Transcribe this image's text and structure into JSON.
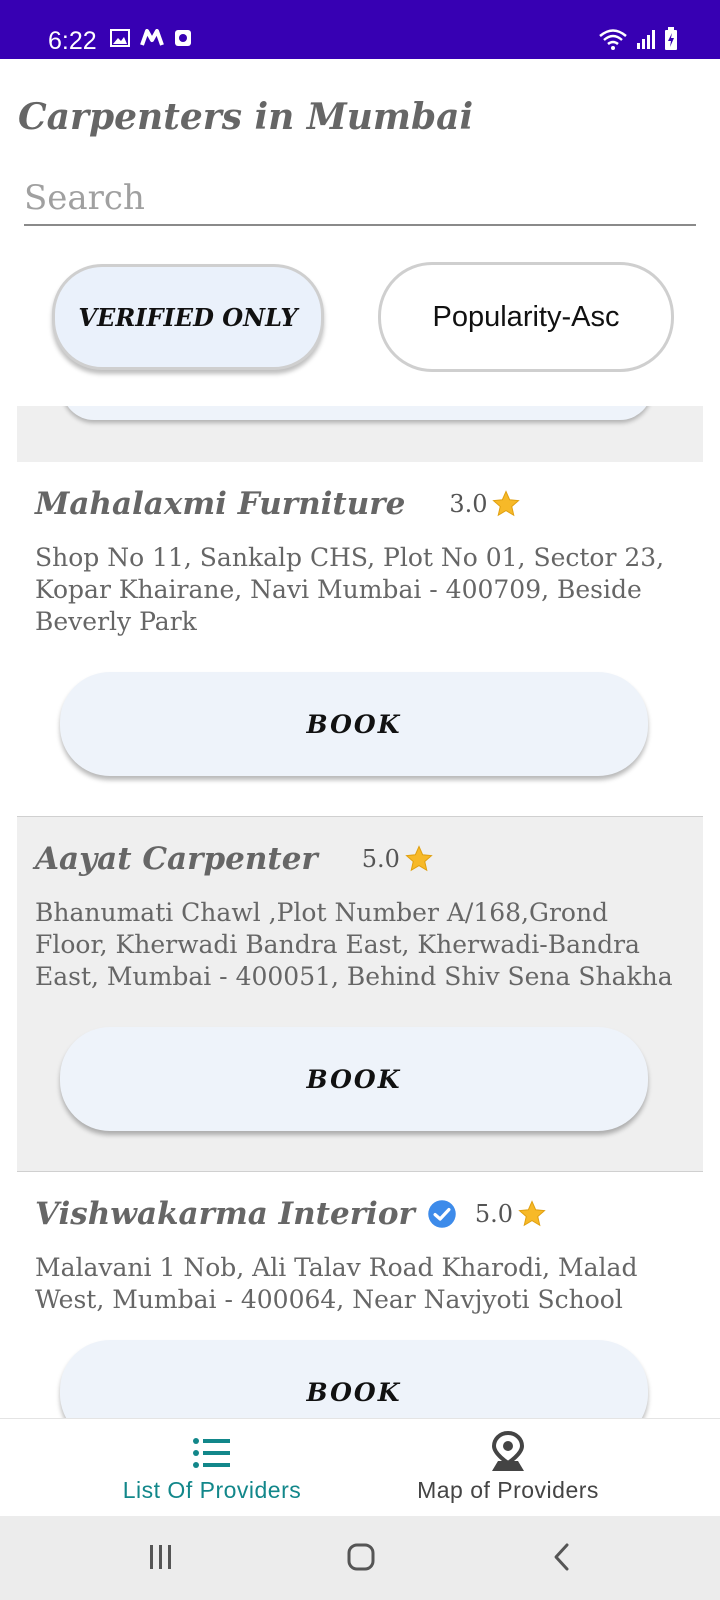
{
  "status_bar": {
    "time": "6:22",
    "left_icons": [
      "image-icon",
      "m-icon",
      "record-icon"
    ],
    "right_icons": [
      "wifi-icon",
      "signal-icon",
      "battery-charging-icon"
    ],
    "background": "#3700b3"
  },
  "header": {
    "title": "Carpenters in Mumbai",
    "search_placeholder": "Search"
  },
  "filters": {
    "verified_label": "VERIFIED ONLY",
    "sort_label": "Popularity-Asc"
  },
  "providers": [
    {
      "name": "Mahalaxmi Furniture",
      "verified": false,
      "rating": "3.0",
      "address": "Shop No 11, Sankalp CHS, Plot No 01, Sector 23, Kopar Khairane, Navi Mumbai - 400709, Beside Beverly Park",
      "book_label": "BOOK"
    },
    {
      "name": "Aayat Carpenter",
      "verified": false,
      "rating": "5.0",
      "address": "Bhanumati Chawl ,Plot Number A/168,Grond Floor, Kherwadi Bandra East, Kherwadi-Bandra East, Mumbai - 400051, Behind Shiv Sena Shakha",
      "book_label": "BOOK"
    },
    {
      "name": "Vishwakarma Interior",
      "verified": true,
      "rating": "5.0",
      "address": "Malavani 1 Nob, Ali Talav Road Kharodi, Malad West, Mumbai - 400064, Near Navjyoti School",
      "book_label": "BOOK"
    }
  ],
  "bottom_nav": {
    "items": [
      {
        "label": "List Of Providers",
        "icon": "list-icon",
        "active": true
      },
      {
        "label": "Map of Providers",
        "icon": "map-pin-icon",
        "active": false
      }
    ],
    "active_color": "#12878a"
  },
  "system_nav": {
    "icons": [
      "recents-icon",
      "home-icon",
      "back-icon"
    ]
  }
}
